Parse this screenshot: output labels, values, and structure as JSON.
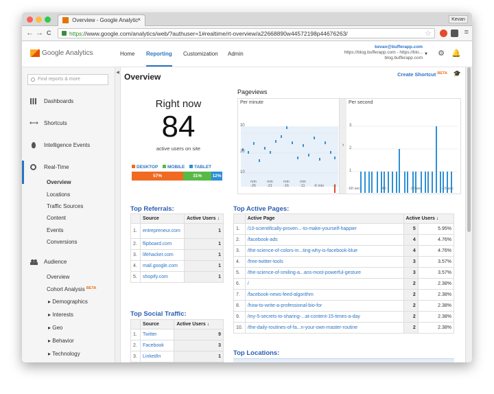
{
  "browser": {
    "tab_title": "Overview - Google Analytic",
    "tab_close": "×",
    "user": "Kevan",
    "url_https": "https",
    "url_rest": "://www.google.com/analytics/web/?authuser=1#realtime/rt-overview/a22668890w44572198p44676263/",
    "back": "←",
    "forward": "→",
    "reload": "C"
  },
  "header": {
    "logo_text": "Google Analytics",
    "nav": [
      "Home",
      "Reporting",
      "Customization",
      "Admin"
    ],
    "account_email": "kevan@bufferapp.com",
    "account_line2": "https://blog.bufferapp.com - https://blo...",
    "account_line3": "blog.bufferapp.com"
  },
  "sidebar": {
    "search_placeholder": "Find reports & more",
    "sections": [
      "Dashboards",
      "Shortcuts",
      "Intelligence Events",
      "Real-Time",
      "Audience"
    ],
    "realtime_items": [
      "Overview",
      "Locations",
      "Traffic Sources",
      "Content",
      "Events",
      "Conversions"
    ],
    "audience_items": [
      "Overview",
      "Cohort Analysis",
      "▸ Demographics",
      "▸ Interests",
      "▸ Geo",
      "▸ Behavior",
      "▸ Technology"
    ],
    "beta": "BETA"
  },
  "main": {
    "title": "Overview",
    "create_shortcut": "Create Shortcut",
    "beta": "BETA",
    "right_now_title": "Right now",
    "active_users": "84",
    "active_users_label": "active users on site",
    "devices": [
      {
        "label": "DESKTOP",
        "pct": "57%",
        "value": 57,
        "color": "#f06a22"
      },
      {
        "label": "MOBILE",
        "pct": "31%",
        "value": 31,
        "color": "#58b947"
      },
      {
        "label": "TABLET",
        "pct": "12%",
        "value": 12,
        "color": "#2d8fd5"
      }
    ],
    "pageviews": {
      "title": "Pageviews",
      "per_minute": "Per minute",
      "per_second": "Per second",
      "arrow": "›",
      "pm_yticks": [
        "30",
        "20",
        "10"
      ],
      "pm_xticks": [
        "min\n-26",
        "min\n-21",
        "min\n-16",
        "min\n-11",
        "-6 min",
        "-1"
      ],
      "ps_yticks": [
        "3",
        "2",
        "1"
      ],
      "ps_xticks": [
        "-60 sec",
        "-45",
        "-30 sec",
        "-15 sec"
      ]
    },
    "top_referrals": {
      "title": "Top Referrals:",
      "cols": [
        "Source",
        "Active Users ↓"
      ],
      "rows": [
        [
          "1.",
          "entrepreneur.com",
          "1"
        ],
        [
          "2.",
          "flipboard.com",
          "1"
        ],
        [
          "3.",
          "lifehacker.com",
          "1"
        ],
        [
          "4.",
          "mail.google.com",
          "1"
        ],
        [
          "5.",
          "shopify.com",
          "1"
        ]
      ]
    },
    "top_social": {
      "title": "Top Social Traffic:",
      "cols": [
        "Source",
        "Active Users ↓"
      ],
      "rows": [
        [
          "1.",
          "Twitter",
          "9"
        ],
        [
          "2.",
          "Facebook",
          "3"
        ],
        [
          "3.",
          "LinkedIn",
          "1"
        ]
      ]
    },
    "top_pages": {
      "title": "Top Active Pages:",
      "cols": [
        "Active Page",
        "Active Users ↓"
      ],
      "rows": [
        [
          "1.",
          "/10-scientifically-proven...-to-make-yourself-happier",
          "5",
          "5.95%"
        ],
        [
          "2.",
          "/facebook-ads",
          "4",
          "4.76%"
        ],
        [
          "3.",
          "/the-science-of-colors-in...ting-why-is-facebook-blue",
          "4",
          "4.76%"
        ],
        [
          "4.",
          "/free-twitter-tools",
          "3",
          "3.57%"
        ],
        [
          "5.",
          "/the-science-of-smiling-a...ans-most-powerful-gesture",
          "3",
          "3.57%"
        ],
        [
          "6.",
          "/",
          "2",
          "2.38%"
        ],
        [
          "7.",
          "/facebook-news-feed-algorithm",
          "2",
          "2.38%"
        ],
        [
          "8.",
          "/how-to-write-a-professional-bio-for",
          "2",
          "2.38%"
        ],
        [
          "9.",
          "/my-5-secrets-to-sharing-...at-content-15-times-a-day",
          "2",
          "2.38%"
        ],
        [
          "10.",
          "/the-daily-routines-of-fa...n-your-own-master-routine",
          "2",
          "2.38%"
        ]
      ]
    },
    "top_locations": "Top Locations:"
  }
}
